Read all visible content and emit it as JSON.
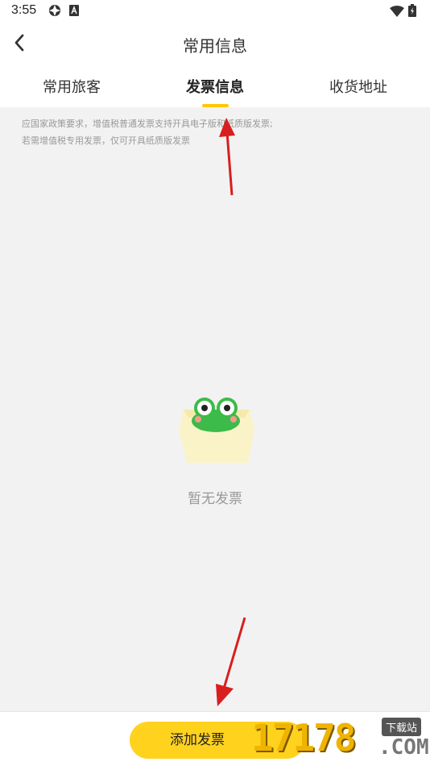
{
  "status_bar": {
    "time": "3:55",
    "icons": [
      "settings-app-icon",
      "a-notification-icon",
      "wifi-icon",
      "battery-icon"
    ]
  },
  "header": {
    "back_icon": "chevron-left-icon",
    "title": "常用信息"
  },
  "tabs": [
    {
      "label": "常用旅客",
      "active": false
    },
    {
      "label": "发票信息",
      "active": true
    },
    {
      "label": "收货地址",
      "active": false
    }
  ],
  "notice": {
    "line1": "应国家政策要求，增值税普通发票支持开具电子版和纸质版发票;",
    "line2": "若需增值税专用发票，仅可开具纸质版发票"
  },
  "empty_state": {
    "illustration": "frog-in-box-illustration",
    "text": "暂无发票"
  },
  "bottom": {
    "add_button_label": "添加发票"
  },
  "watermark": {
    "digits": "17178",
    "label": "下载站",
    "com": ".COM"
  },
  "colors": {
    "accent": "#ffc800",
    "button": "#ffd21e",
    "annotation_arrow": "#d81e1e",
    "background": "#f2f2f2"
  }
}
